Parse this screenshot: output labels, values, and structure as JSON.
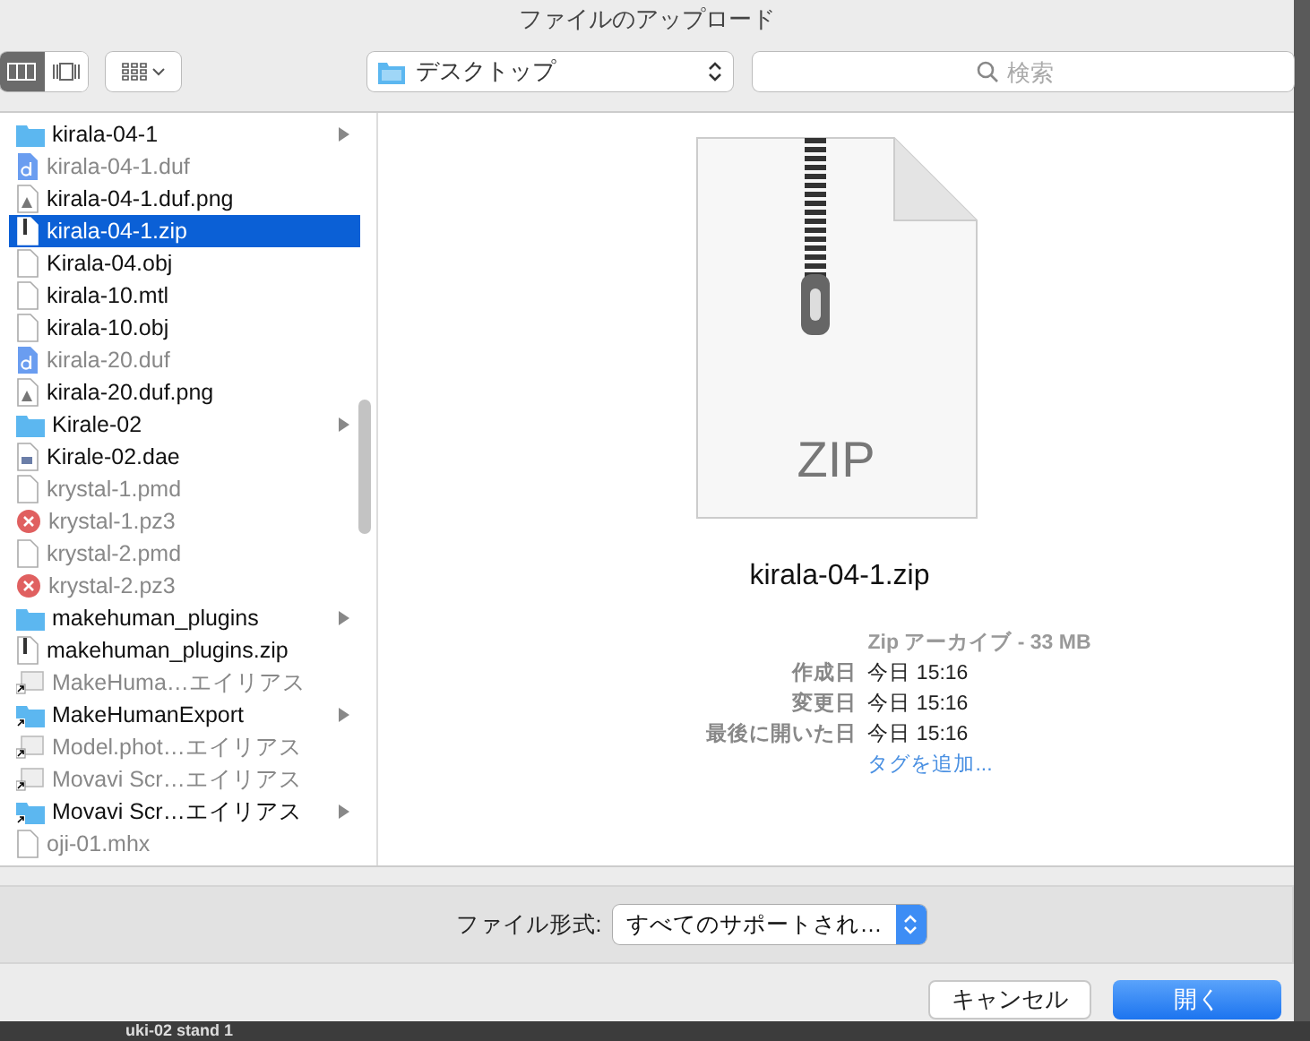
{
  "window": {
    "title": "ファイルのアップロード"
  },
  "toolbar": {
    "view_modes": [
      {
        "kind": "columns",
        "selected": true
      },
      {
        "kind": "coverflow",
        "selected": false
      }
    ],
    "location": "デスクトップ",
    "search": {
      "placeholder": "検索"
    }
  },
  "files": [
    {
      "name": "kirala-04-1",
      "kind": "folder",
      "disabled": false,
      "expandable": true,
      "selected": false
    },
    {
      "name": "kirala-04-1.duf",
      "kind": "duf",
      "disabled": true,
      "expandable": false,
      "selected": false
    },
    {
      "name": "kirala-04-1.duf.png",
      "kind": "image",
      "disabled": false,
      "expandable": false,
      "selected": false
    },
    {
      "name": "kirala-04-1.zip",
      "kind": "zip",
      "disabled": false,
      "expandable": false,
      "selected": true
    },
    {
      "name": "Kirala-04.obj",
      "kind": "file",
      "disabled": false,
      "expandable": false,
      "selected": false
    },
    {
      "name": "kirala-10.mtl",
      "kind": "file",
      "disabled": false,
      "expandable": false,
      "selected": false
    },
    {
      "name": "kirala-10.obj",
      "kind": "file",
      "disabled": false,
      "expandable": false,
      "selected": false
    },
    {
      "name": "kirala-20.duf",
      "kind": "duf",
      "disabled": true,
      "expandable": false,
      "selected": false
    },
    {
      "name": "kirala-20.duf.png",
      "kind": "image",
      "disabled": false,
      "expandable": false,
      "selected": false
    },
    {
      "name": "Kirale-02",
      "kind": "folder",
      "disabled": false,
      "expandable": true,
      "selected": false
    },
    {
      "name": "Kirale-02.dae",
      "kind": "dae",
      "disabled": false,
      "expandable": false,
      "selected": false
    },
    {
      "name": "krystal-1.pmd",
      "kind": "file",
      "disabled": true,
      "expandable": false,
      "selected": false
    },
    {
      "name": "krystal-1.pz3",
      "kind": "pz3",
      "disabled": true,
      "expandable": false,
      "selected": false
    },
    {
      "name": "krystal-2.pmd",
      "kind": "file",
      "disabled": true,
      "expandable": false,
      "selected": false
    },
    {
      "name": "krystal-2.pz3",
      "kind": "pz3",
      "disabled": true,
      "expandable": false,
      "selected": false
    },
    {
      "name": "makehuman_plugins",
      "kind": "folder",
      "disabled": false,
      "expandable": true,
      "selected": false
    },
    {
      "name": "makehuman_plugins.zip",
      "kind": "zip",
      "disabled": false,
      "expandable": false,
      "selected": false
    },
    {
      "name": "MakeHuma…エイリアス",
      "kind": "alias",
      "disabled": true,
      "expandable": false,
      "selected": false
    },
    {
      "name": "MakeHumanExport",
      "kind": "alias-folder",
      "disabled": false,
      "expandable": true,
      "selected": false
    },
    {
      "name": "Model.phot…エイリアス",
      "kind": "alias",
      "disabled": true,
      "expandable": false,
      "selected": false
    },
    {
      "name": "Movavi Scr…エイリアス",
      "kind": "alias",
      "disabled": true,
      "expandable": false,
      "selected": false
    },
    {
      "name": "Movavi Scr…エイリアス",
      "kind": "alias-folder",
      "disabled": false,
      "expandable": true,
      "selected": false
    },
    {
      "name": "oji-01.mhx",
      "kind": "file",
      "disabled": true,
      "expandable": false,
      "selected": false
    }
  ],
  "preview": {
    "icon_label": "ZIP",
    "filename": "kirala-04-1.zip",
    "type_size": "Zip アーカイブ - 33 MB",
    "details": [
      {
        "label": "作成日",
        "value": "今日 15:16"
      },
      {
        "label": "変更日",
        "value": "今日 15:16"
      },
      {
        "label": "最後に開いた日",
        "value": "今日 15:16"
      }
    ],
    "add_tags": "タグを追加..."
  },
  "format": {
    "label": "ファイル形式:",
    "value": "すべてのサポートされ…"
  },
  "buttons": [
    {
      "label": "キャンセル",
      "kind": "secondary"
    },
    {
      "label": "開く",
      "kind": "primary"
    }
  ],
  "background_text": "uki-02 stand 1"
}
